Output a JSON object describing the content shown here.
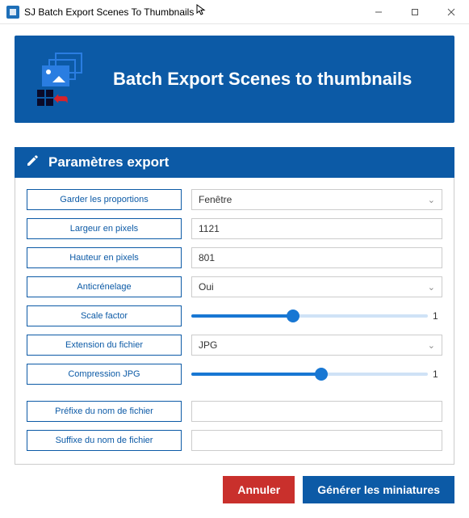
{
  "window": {
    "title": "SJ Batch Export Scenes To Thumbnails"
  },
  "hero": {
    "title": "Batch Export Scenes to thumbnails"
  },
  "section": {
    "title": "Paramètres export"
  },
  "labels": {
    "keep_proportions": "Garder les proportions",
    "width_px": "Largeur en pixels",
    "height_px": "Hauteur en pixels",
    "antialias": "Anticrénelage",
    "scale_factor": "Scale factor",
    "file_ext": "Extension du fichier",
    "jpg_compression": "Compression JPG",
    "filename_prefix": "Préfixe du nom de fichier",
    "filename_suffix": "Suffixe du nom de fichier"
  },
  "values": {
    "keep_proportions": "Fenêtre",
    "width_px": "1121",
    "height_px": "801",
    "antialias": "Oui",
    "scale_factor": "1",
    "scale_factor_pct": 43,
    "file_ext": "JPG",
    "jpg_compression": "1",
    "jpg_compression_pct": 55,
    "filename_prefix": "",
    "filename_suffix": ""
  },
  "actions": {
    "cancel": "Annuler",
    "generate": "Générer les miniatures"
  }
}
